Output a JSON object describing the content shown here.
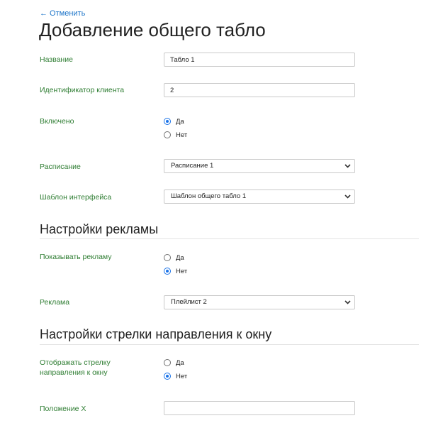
{
  "header": {
    "back_link": "← Отменить",
    "title": "Добавление общего табло"
  },
  "fields": {
    "name": {
      "label": "Название",
      "value": "Табло 1"
    },
    "client_id": {
      "label": "Идентификатор клиента",
      "value": "2"
    },
    "enabled": {
      "label": "Включено",
      "options": [
        {
          "label": "Да",
          "checked": true
        },
        {
          "label": "Нет",
          "checked": false
        }
      ]
    },
    "schedule": {
      "label": "Расписание",
      "value": "Расписание 1"
    },
    "interface_template": {
      "label": "Шаблон интерфейса",
      "value": "Шаблон общего табло 1"
    }
  },
  "ads_section": {
    "title": "Настройки рекламы",
    "show_ads": {
      "label": "Показывать рекламу",
      "options": [
        {
          "label": "Да",
          "checked": false
        },
        {
          "label": "Нет",
          "checked": true
        }
      ]
    },
    "ad": {
      "label": "Реклама",
      "value": "Плейлист 2"
    }
  },
  "arrow_section": {
    "title": "Настройки стрелки направления к окну",
    "show_arrow": {
      "label_line1": "Отображать стрелку",
      "label_line2": "направления к окну",
      "options": [
        {
          "label": "Да",
          "checked": false
        },
        {
          "label": "Нет",
          "checked": true
        }
      ]
    },
    "position_x": {
      "label": "Положение X",
      "value": ""
    }
  },
  "colors": {
    "label_green": "#2e7d32",
    "link_blue": "#1a73c8",
    "radio_blue": "#1a73e8"
  }
}
